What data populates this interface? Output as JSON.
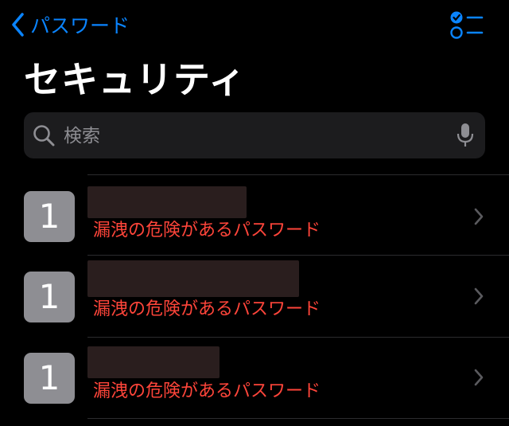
{
  "nav": {
    "back_label": "パスワード"
  },
  "title": "セキュリティ",
  "search": {
    "placeholder": "検索"
  },
  "rows": [
    {
      "badge": "1",
      "warning": "漏洩の危険があるパスワード"
    },
    {
      "badge": "1",
      "warning": "漏洩の危険があるパスワード"
    },
    {
      "badge": "1",
      "warning": "漏洩の危険があるパスワード"
    }
  ],
  "colors": {
    "accent": "#0a84ff",
    "warning": "#ff453a",
    "badge": "#8e8e93",
    "search_bg": "#1c1c1e"
  }
}
